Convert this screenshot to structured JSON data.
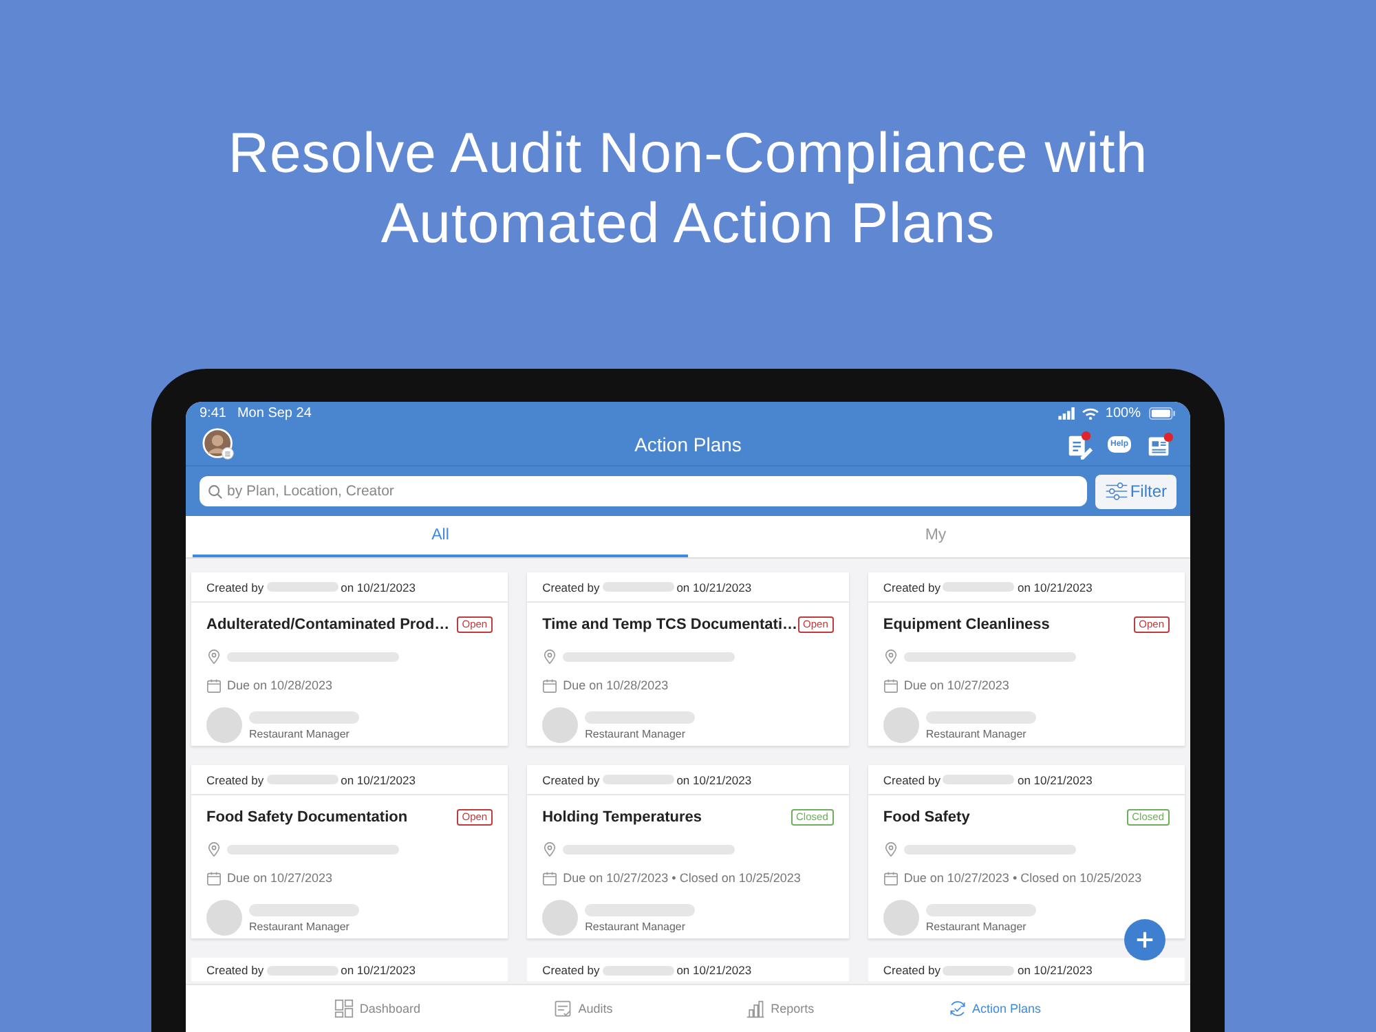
{
  "headline": [
    "Resolve Audit Non-Compliance with",
    "Automated Action Plans"
  ],
  "status_bar": {
    "time": "9:41",
    "date": "Mon Sep 24",
    "battery": "100%"
  },
  "header": {
    "title": "Action Plans",
    "actions": [
      {
        "kind": "notes",
        "badge": true
      },
      {
        "kind": "help",
        "label": "Help",
        "badge": false
      },
      {
        "kind": "news",
        "badge": true
      }
    ]
  },
  "search": {
    "placeholder": "by Plan, Location, Creator",
    "filter": "Filter"
  },
  "tabs": [
    {
      "label": "All",
      "selected": true
    },
    {
      "label": "My",
      "selected": false
    }
  ],
  "cards": [
    {
      "created_by": "Created by",
      "created_on": "on 10/21/2023",
      "title": "Adulterated/Contaminated Prod…",
      "status": {
        "label": "Open",
        "kind": "open"
      },
      "due": "Due on 10/28/2023",
      "role": "Restaurant Manager"
    },
    {
      "created_by": "Created by",
      "created_on": "on 10/21/2023",
      "title": "Time and Temp TCS Documentati…",
      "status": {
        "label": "Open",
        "kind": "open"
      },
      "due": "Due on 10/28/2023",
      "role": "Restaurant Manager"
    },
    {
      "created_by": "Created by",
      "created_on": "on 10/21/2023",
      "title": "Equipment Cleanliness",
      "status": {
        "label": "Open",
        "kind": "open"
      },
      "due": "Due on 10/27/2023",
      "role": "Restaurant Manager"
    },
    {
      "created_by": "Created by",
      "created_on": "on 10/21/2023",
      "title": "Food Safety Documentation",
      "status": {
        "label": "Open",
        "kind": "open"
      },
      "due": "Due on 10/27/2023",
      "role": "Restaurant Manager"
    },
    {
      "created_by": "Created by",
      "created_on": "on 10/21/2023",
      "title": "Holding Temperatures",
      "status": {
        "label": "Closed",
        "kind": "closed"
      },
      "due": "Due on 10/27/2023 • Closed on 10/25/2023",
      "role": "Restaurant Manager"
    },
    {
      "created_by": "Created by",
      "created_on": "on 10/21/2023",
      "title": "Food Safety",
      "status": {
        "label": "Closed",
        "kind": "closed"
      },
      "due": "Due on 10/27/2023 • Closed on 10/25/2023",
      "role": "Restaurant Manager"
    },
    {
      "created_by": "Created by",
      "created_on": "on 10/21/2023"
    },
    {
      "created_by": "Created by",
      "created_on": "on 10/21/2023"
    },
    {
      "created_by": "Created by",
      "created_on": "on 10/21/2023"
    }
  ],
  "bottom_nav": [
    {
      "kind": "dashboard",
      "label": "Dashboard",
      "selected": false
    },
    {
      "kind": "audits",
      "label": "Audits",
      "selected": false
    },
    {
      "kind": "reports",
      "label": "Reports",
      "selected": false
    },
    {
      "kind": "plans",
      "label": "Action Plans",
      "selected": true
    }
  ]
}
